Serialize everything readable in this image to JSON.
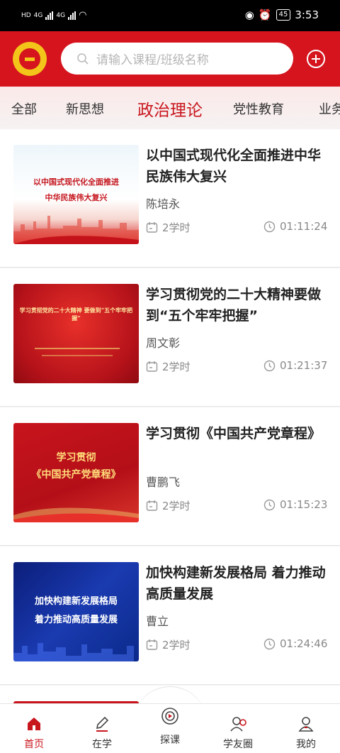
{
  "status": {
    "left_tags": [
      "HD",
      "HD"
    ],
    "network": "4G",
    "battery": "45",
    "time": "3:53"
  },
  "search": {
    "placeholder": "请输入课程/班级名称"
  },
  "tabs": [
    "全部",
    "新思想",
    "政治理论",
    "党性教育",
    "业务"
  ],
  "active_tab": "政治理论",
  "courses": [
    {
      "title": "以中国式现代化全面推进中华民族伟大复兴",
      "author": "陈培永",
      "hours": "2学时",
      "duration": "01:11:24",
      "thumb_lines": [
        "以中国式现代化全面推进",
        "中华民族伟大复兴"
      ]
    },
    {
      "title": "学习贯彻党的二十大精神要做到“五个牢牢把握”",
      "author": "周文彰",
      "hours": "2学时",
      "duration": "01:21:37",
      "thumb_lines": [
        "学习贯彻党的二十大精神 要做到“五个牢牢把握”"
      ]
    },
    {
      "title": "学习贯彻《中国共产党章程》",
      "author": "曹鹏飞",
      "hours": "2学时",
      "duration": "01:15:23",
      "thumb_lines": [
        "学习贯彻",
        "《中国共产党章程》"
      ]
    },
    {
      "title": "加快构建新发展格局 着力推动高质量发展",
      "author": "曹立",
      "hours": "2学时",
      "duration": "01:24:46",
      "thumb_lines": [
        "加快构建新发展格局",
        "着力推动高质量发展"
      ]
    }
  ],
  "bottom_nav": [
    {
      "label": "首页",
      "icon": "home-icon",
      "active": true
    },
    {
      "label": "在学",
      "icon": "pencil-icon",
      "active": false
    },
    {
      "label": "探课",
      "icon": "play-circle-icon",
      "active": false
    },
    {
      "label": "学友圈",
      "icon": "friends-icon",
      "active": false
    },
    {
      "label": "我的",
      "icon": "user-icon",
      "active": false
    }
  ],
  "colors": {
    "brand_red": "#d5141e",
    "accent_gold": "#f3c419",
    "active_text": "#c8161d"
  }
}
